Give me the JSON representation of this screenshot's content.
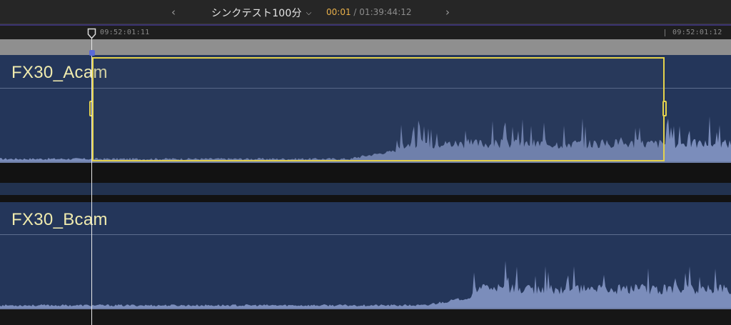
{
  "header": {
    "prev_icon": "chevron-left-icon",
    "next_icon": "chevron-right-icon",
    "project_name": "シンクテスト100分",
    "project_menu_icon": "chevron-down-icon",
    "current_timecode": "00:01",
    "separator": "/",
    "duration_timecode": "01:39:44:12"
  },
  "ruler": {
    "labels": [
      "09:52:01:11",
      "09:52:01:12"
    ]
  },
  "tracks": [
    {
      "clip_name": "FX30_Acam",
      "selected": true
    },
    {
      "clip_name": "FX30_Bcam",
      "selected": false
    }
  ],
  "colors": {
    "clip_bg": "#24365a",
    "clip_name": "#f0ebae",
    "selection": "#e4d24c",
    "current_timecode": "#e9b04a",
    "waveform": "#7b8dbb",
    "playhead_marker": "#5a6ad8"
  }
}
